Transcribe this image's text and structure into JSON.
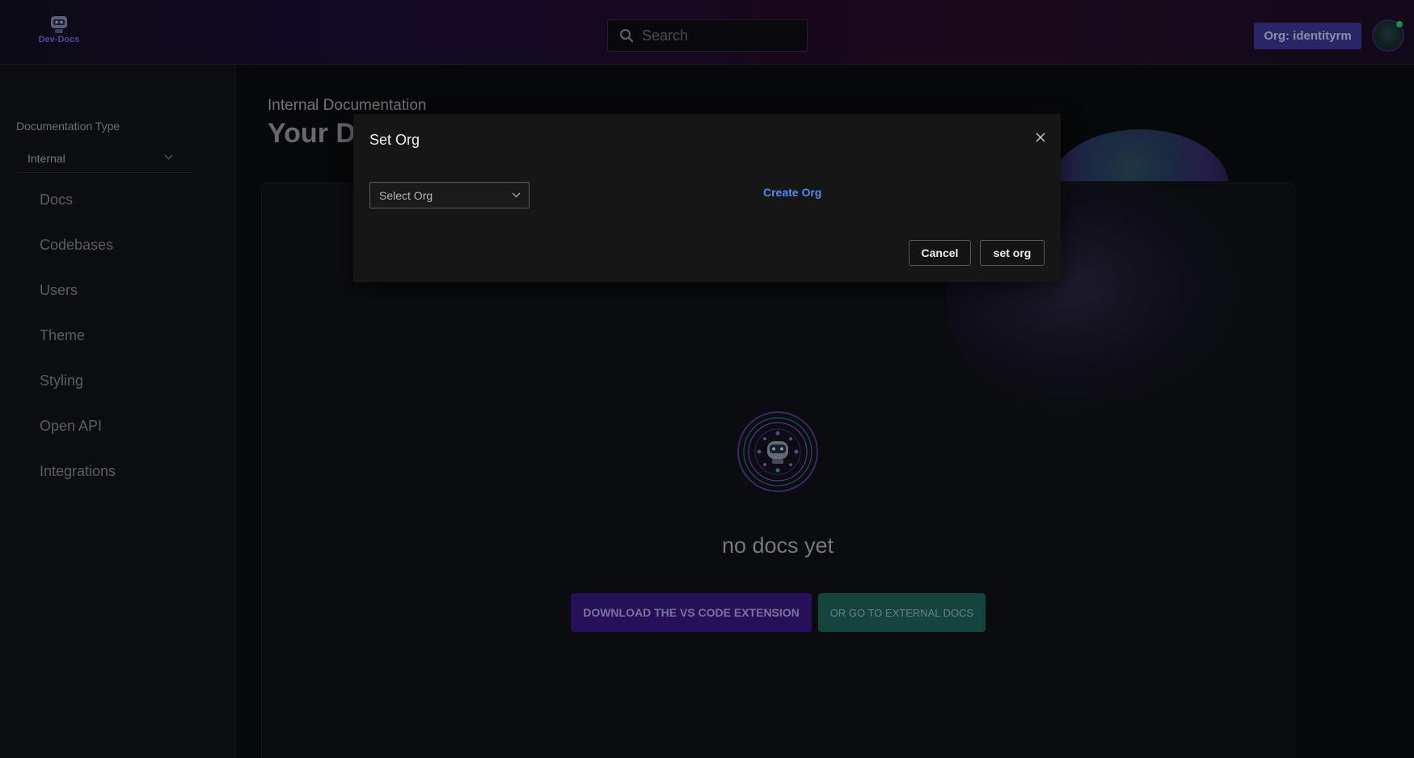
{
  "header": {
    "logo_text": "Dev-Docs",
    "search_placeholder": "Search",
    "org_badge": "Org: identityrm"
  },
  "sidebar": {
    "doc_type_label": "Documentation Type",
    "doc_type_value": "Internal",
    "items": [
      {
        "label": "Docs"
      },
      {
        "label": "Codebases"
      },
      {
        "label": "Users"
      },
      {
        "label": "Theme"
      },
      {
        "label": "Styling"
      },
      {
        "label": "Open API"
      },
      {
        "label": "Integrations"
      }
    ]
  },
  "main": {
    "subtitle": "Internal Documentation",
    "title": "Your Docs",
    "empty_text": "no docs yet",
    "download_button": "DOWNLOAD THE VS CODE EXTENSION",
    "external_button": "OR GO TO EXTERNAL DOCS"
  },
  "modal": {
    "title": "Set Org",
    "select_placeholder": "Select Org",
    "create_link": "Create Org",
    "cancel_button": "Cancel",
    "confirm_button": "set org"
  },
  "colors": {
    "accent_purple": "#3f3a9e",
    "download_button": "#3d1a8a",
    "external_button": "#1f6b5c",
    "link_blue": "#4a8ef0",
    "status_online": "#2ed573"
  }
}
